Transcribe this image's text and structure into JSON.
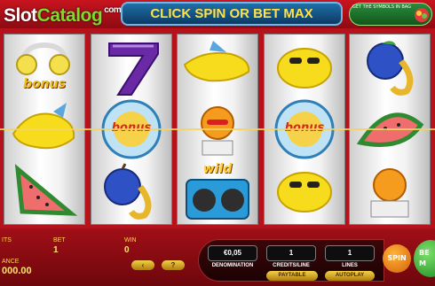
{
  "watermark": {
    "part1": "Slot",
    "part2": "Catalog",
    "part3": "com"
  },
  "banner": {
    "text": "CLICK SPIN OR BET MAX"
  },
  "topright": {
    "title": "GET THE SYMBOLS IN BAG"
  },
  "reels": [
    {
      "symbols": [
        "headphones-bonus",
        "lemon",
        "watermelon"
      ],
      "labels": [
        "bonus",
        "",
        ""
      ]
    },
    {
      "symbols": [
        "seven",
        "bonus-wheel",
        "plum-saxophone"
      ],
      "labels": [
        "",
        "bonus",
        ""
      ]
    },
    {
      "symbols": [
        "lemon",
        "orange-drum",
        "speaker-wild"
      ],
      "labels": [
        "",
        "",
        "wild"
      ]
    },
    {
      "symbols": [
        "lemon-sunglasses",
        "bonus-wheel",
        "lemon-sunglasses"
      ],
      "labels": [
        "",
        "bonus",
        ""
      ]
    },
    {
      "symbols": [
        "plum-saxophone",
        "watermelon",
        "orange-drum"
      ],
      "labels": [
        "",
        "",
        ""
      ]
    }
  ],
  "panel": {
    "credits_label": "ITS",
    "bet_label": "BET",
    "bet_value": "1",
    "win_label": "WIN",
    "win_value": "0",
    "balance_label": "ANCE",
    "balance_value": "000.00",
    "nav_prev": "‹",
    "nav_help": "?"
  },
  "controls": {
    "denomination_value": "€0,05",
    "denomination_label": "DENOMINATION",
    "credits_line_value": "1",
    "credits_line_label": "CREDITS/LINE",
    "lines_value": "1",
    "lines_label": "LINES",
    "paytable_label": "PAYTABLE",
    "autoplay_label": "AUTOPLAY",
    "spin_label": "SPIN",
    "betmax_label_1": "BE",
    "betmax_label_2": "M"
  },
  "colors": {
    "background": "#b5121b",
    "banner_text": "#ffe14a",
    "accent_green": "#7bdc2a"
  }
}
